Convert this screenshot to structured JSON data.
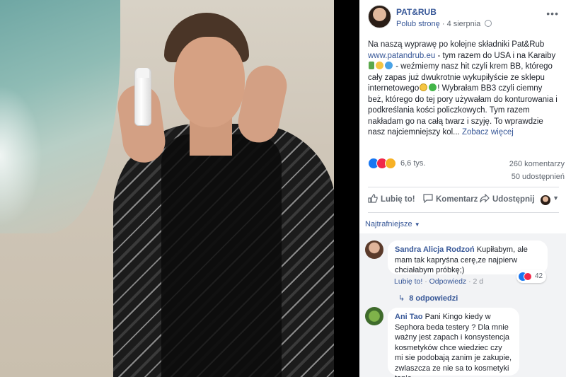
{
  "post": {
    "page_name": "PAT&RUB",
    "like_page": "Polub stronę",
    "date": "4 sierpnia",
    "text_before_link": "Na naszą wyprawę po kolejne składniki Pat&Rub ",
    "link": "www.patandrub.eu",
    "text_after_link": " - tym razem do USA i na Karaiby",
    "text_line_2": " - weźmiemy nasz hit czyli krem BB, którego cały zapas już dwukrotnie wykupiłyście ze sklepu internetowego",
    "text_line_3": "! Wybrałam BB3 czyli ciemny beż, którego do tej pory używałam do konturowania i podkreślania kości policzkowych. Tym razem nakładam go na całą twarz i szyję. To wprawdzie nasz najciemniejszy kol...",
    "see_more": "Zobacz więcej"
  },
  "stats": {
    "reactions": "6,6 tys.",
    "comments": "260 komentarzy",
    "shares": "50 udostępnień"
  },
  "actions": {
    "like": "Lubię to!",
    "comment": "Komentarz",
    "share": "Udostępnij"
  },
  "sort_label": "Najtrafniejsze",
  "comments": [
    {
      "author": "Sandra Alicja Rodzoń",
      "text": "Kupiłabym, ale mam tak kapryśna cerę,ze najpierw chciałabym próbkę;)",
      "like_label": "Lubię to!",
      "reply_label": "Odpowiedz",
      "time": "2 d",
      "reaction_count": "42",
      "replies_label": "8 odpowiedzi"
    },
    {
      "author": "Ani Tao",
      "text": "Pani Kingo kiedy w Sephora beda testery ? Dla mnie ważny jest zapach i konsystencja kosmetyków chce wiedziec czy mi sie podobają zanim je zakupie, zwlaszcza ze nie sa to kosmetyki tanie."
    }
  ],
  "icons": {
    "like": "thumbs-up-icon",
    "comment": "speech-bubble-icon",
    "share": "share-arrow-icon",
    "globe": "globe-icon",
    "more": "more-dots-icon"
  },
  "colors": {
    "link": "#385898",
    "like": "#1877f2",
    "love": "#f0284a",
    "wow": "#f7b125"
  }
}
